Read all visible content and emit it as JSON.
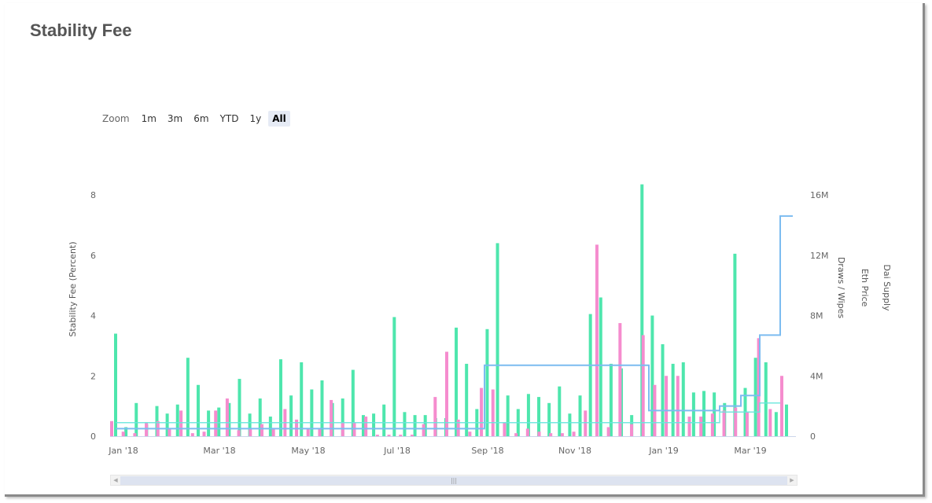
{
  "title": "Stability Fee",
  "zoom": {
    "label": "Zoom",
    "buttons": [
      "1m",
      "3m",
      "6m",
      "YTD",
      "1y",
      "All"
    ],
    "active": "All"
  },
  "colors": {
    "draws": "#4ee6ad",
    "wipes": "#f58cce",
    "dai_supply": "#7cbcf0",
    "stability_fee": "#66e5dc"
  },
  "chart_data": {
    "type": "bar",
    "x_ticks": [
      "Jan '18",
      "Mar '18",
      "May '18",
      "Jul '18",
      "Sep '18",
      "Nov '18",
      "Jan '19",
      "Mar '19"
    ],
    "y_left": {
      "label": "Stability Fee (Percent)",
      "ticks": [
        "0",
        "2",
        "4",
        "6",
        "8"
      ],
      "range": [
        0,
        8
      ]
    },
    "y_right_titles": [
      "Draws / Wipes",
      "Eth Price",
      "Dai Supply"
    ],
    "y_right": {
      "ticks": [
        "0",
        "4M",
        "8M",
        "12M",
        "16M"
      ],
      "range": [
        0,
        16000000
      ]
    },
    "series": [
      {
        "name": "Draws",
        "units": "M",
        "values": [
          6.8,
          0.6,
          2.2,
          0.8,
          2.0,
          1.5,
          2.1,
          5.2,
          3.4,
          1.7,
          1.9,
          2.2,
          3.8,
          1.5,
          2.5,
          1.3,
          5.1,
          2.7,
          4.9,
          3.1,
          3.7,
          2.2,
          2.5,
          4.4,
          1.4,
          1.5,
          2.1,
          7.9,
          1.6,
          1.4,
          1.4,
          1.2,
          1.2,
          7.2,
          4.8,
          1.8,
          7.1,
          12.8,
          2.7,
          1.8,
          2.8,
          2.6,
          2.2,
          3.3,
          1.5,
          2.7,
          8.1,
          9.2,
          4.8,
          4.5,
          1.4,
          16.7,
          8.0,
          6.1,
          4.8,
          4.9,
          2.9,
          3.0,
          2.9,
          2.2,
          12.1,
          3.2,
          5.2,
          4.9,
          1.6,
          2.1
        ]
      },
      {
        "name": "Wipes",
        "units": "M",
        "values": [
          1.0,
          0.3,
          0.2,
          0.9,
          1.0,
          0.5,
          1.7,
          0.2,
          0.3,
          1.7,
          2.5,
          0.4,
          0.5,
          0.8,
          0.5,
          1.8,
          1.1,
          0.5,
          0.5,
          2.4,
          0.9,
          0.9,
          1.3,
          0.1,
          0.1,
          0.1,
          0.1,
          0.8,
          2.6,
          5.6,
          1.1,
          0.3,
          3.2,
          3.1,
          0.9,
          0.2,
          0.5,
          0.3,
          0.2,
          0.2,
          0.3,
          1.7,
          12.7,
          0.6,
          7.5,
          0.8,
          6.7,
          3.4,
          4.0,
          4.0,
          1.3,
          1.3,
          1.5,
          1.7,
          1.9,
          1.6,
          6.5,
          1.8,
          4.0
        ]
      },
      {
        "name": "Dai Supply",
        "units": "M",
        "values": [
          0.5,
          2.0,
          4.5,
          15.0
        ]
      }
    ]
  }
}
